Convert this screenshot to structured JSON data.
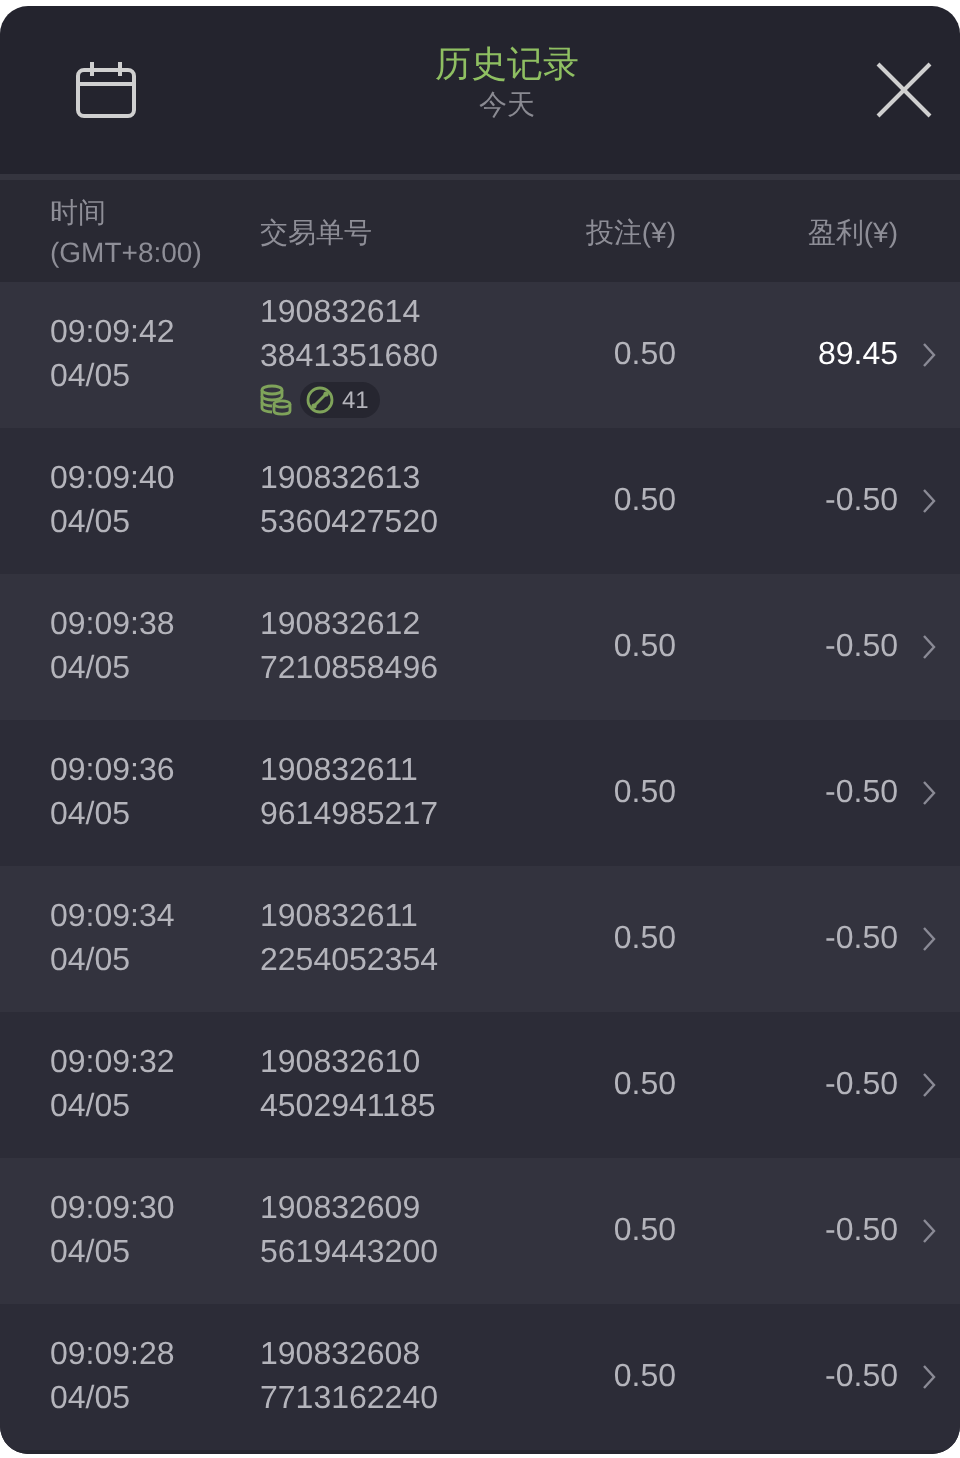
{
  "header": {
    "title": "历史记录",
    "subtitle": "今天"
  },
  "columns": [
    {
      "label": "时间",
      "sublabel": "(GMT+8:00)"
    },
    {
      "label": "交易单号"
    },
    {
      "label": "投注(¥)"
    },
    {
      "label": "盈利(¥)"
    }
  ],
  "rows": [
    {
      "time": "09:09:42",
      "date": "04/05",
      "order_1": "190832614",
      "order_2": "3841351680",
      "stake": "0.50",
      "profit": "89.45",
      "win": true,
      "badge": "41"
    },
    {
      "time": "09:09:40",
      "date": "04/05",
      "order_1": "190832613",
      "order_2": "5360427520",
      "stake": "0.50",
      "profit": "-0.50",
      "win": false
    },
    {
      "time": "09:09:38",
      "date": "04/05",
      "order_1": "190832612",
      "order_2": "7210858496",
      "stake": "0.50",
      "profit": "-0.50",
      "win": false
    },
    {
      "time": "09:09:36",
      "date": "04/05",
      "order_1": "190832611",
      "order_2": "9614985217",
      "stake": "0.50",
      "profit": "-0.50",
      "win": false
    },
    {
      "time": "09:09:34",
      "date": "04/05",
      "order_1": "190832611",
      "order_2": "2254052354",
      "stake": "0.50",
      "profit": "-0.50",
      "win": false
    },
    {
      "time": "09:09:32",
      "date": "04/05",
      "order_1": "190832610",
      "order_2": "4502941185",
      "stake": "0.50",
      "profit": "-0.50",
      "win": false
    },
    {
      "time": "09:09:30",
      "date": "04/05",
      "order_1": "190832609",
      "order_2": "5619443200",
      "stake": "0.50",
      "profit": "-0.50",
      "win": false
    },
    {
      "time": "09:09:28",
      "date": "04/05",
      "order_1": "190832608",
      "order_2": "7713162240",
      "stake": "0.50",
      "profit": "-0.50",
      "win": false
    }
  ]
}
